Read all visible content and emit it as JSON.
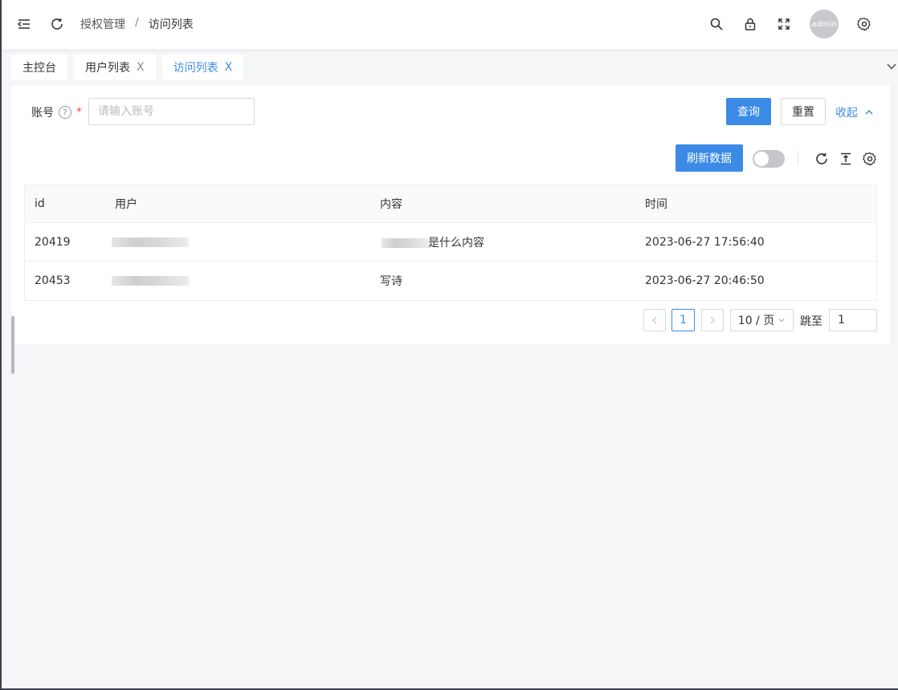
{
  "header": {
    "breadcrumb": [
      "授权管理",
      "访问列表"
    ],
    "breadcrumb_sep": "/",
    "avatar_text": "admin",
    "icons": [
      "menu-fold-icon",
      "reload-icon",
      "search-icon",
      "lock-icon",
      "fullscreen-icon",
      "settings-icon"
    ]
  },
  "tabs": [
    {
      "label": "主控台",
      "closable": false,
      "active": false
    },
    {
      "label": "用户列表",
      "closable": true,
      "active": false
    },
    {
      "label": "访问列表",
      "closable": true,
      "active": true
    }
  ],
  "tab_close": "X",
  "search": {
    "label": "账号",
    "help": "?",
    "required": "*",
    "placeholder": "请输入账号",
    "query_label": "查询",
    "reset_label": "重置",
    "collapse_label": "收起"
  },
  "toolbar": {
    "refresh_label": "刷新数据",
    "toggle_on": false
  },
  "table": {
    "columns": [
      "id",
      "用户",
      "内容",
      "时间"
    ],
    "rows": [
      {
        "id": "20419",
        "content_visible": "是什么内容",
        "time": "2023-06-27 17:56:40"
      },
      {
        "id": "20453",
        "content_visible": "写诗",
        "time": "2023-06-27 20:46:50"
      }
    ]
  },
  "pagination": {
    "current": "1",
    "page_size": "10 / 页",
    "jump_label": "跳至",
    "jump_value": "1"
  },
  "colors": {
    "primary": "#3b8be6",
    "background": "#f5f6f8"
  }
}
